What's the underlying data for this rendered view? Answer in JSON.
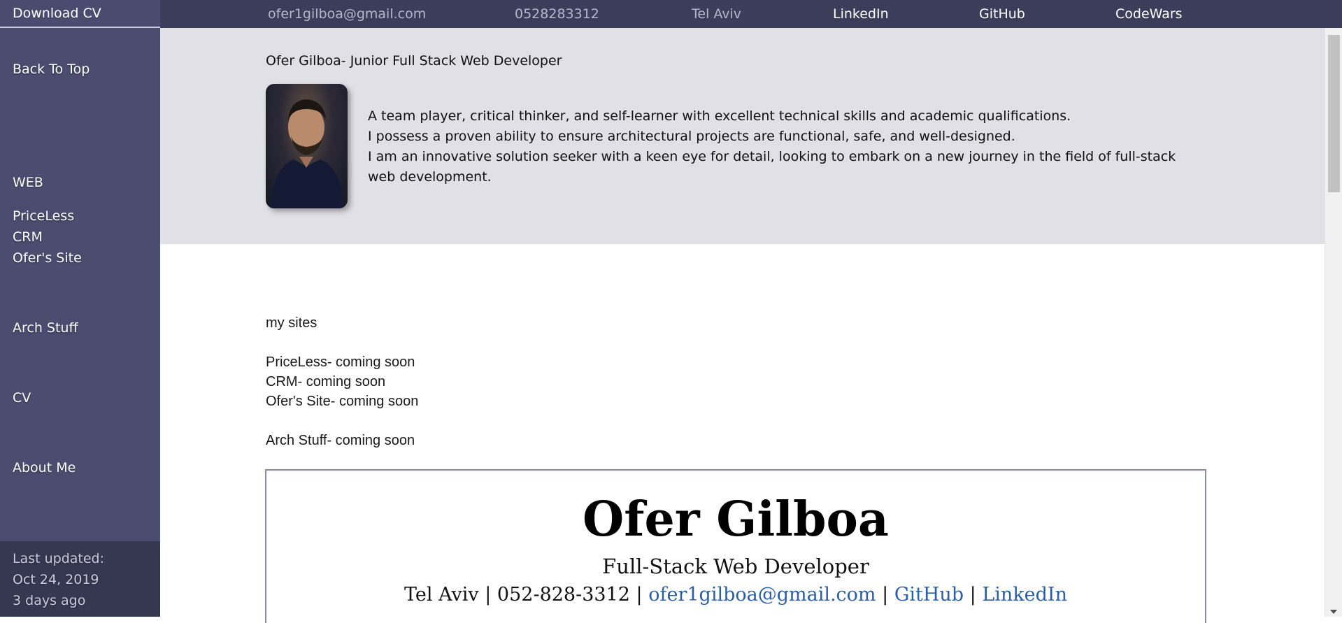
{
  "topbar": {
    "download": "Download CV",
    "email": "ofer1gilboa@gmail.com",
    "phone": "0528283312",
    "location": "Tel Aviv",
    "linkedin": "LinkedIn",
    "github": "GitHub",
    "codewars": "CodeWars"
  },
  "sidebar": {
    "back_to_top": "Back To Top",
    "web": "WEB",
    "priceless": "PriceLess",
    "crm": "CRM",
    "ofers_site": "Ofer's Site",
    "arch_stuff": "Arch Stuff",
    "cv": "CV",
    "about_me": "About Me",
    "footer": {
      "last_updated": "Last updated:",
      "date": "Oct 24, 2019",
      "ago": "3 days ago"
    }
  },
  "header": {
    "title": "Ofer Gilboa- Junior Full Stack Web Developer",
    "bio": [
      "A team player, critical thinker, and self-learner with excellent technical skills and academic qualifications.",
      "I possess a proven ability to ensure architectural projects are functional, safe, and well-designed.",
      "I am an innovative solution seeker with a keen eye for detail, looking to embark on a new journey in the field of full-stack web development."
    ]
  },
  "content": {
    "heading": "my sites",
    "items": [
      "PriceLess- coming soon",
      "CRM- coming soon",
      "Ofer's Site- coming soon"
    ],
    "arch": "Arch Stuff- coming soon"
  },
  "cv": {
    "name": "Ofer Gilboa",
    "role": "Full-Stack Web Developer",
    "location": "Tel Aviv",
    "phone": "052-828-3312",
    "email": "ofer1gilboa@gmail.com",
    "github": "GitHub",
    "linkedin": "LinkedIn",
    "separator": " | "
  },
  "colors": {
    "topbar": "#3c3d5a",
    "sidebar": "#4b4c70",
    "header_panel": "#e0e0e6",
    "link": "#2a5ea8"
  }
}
